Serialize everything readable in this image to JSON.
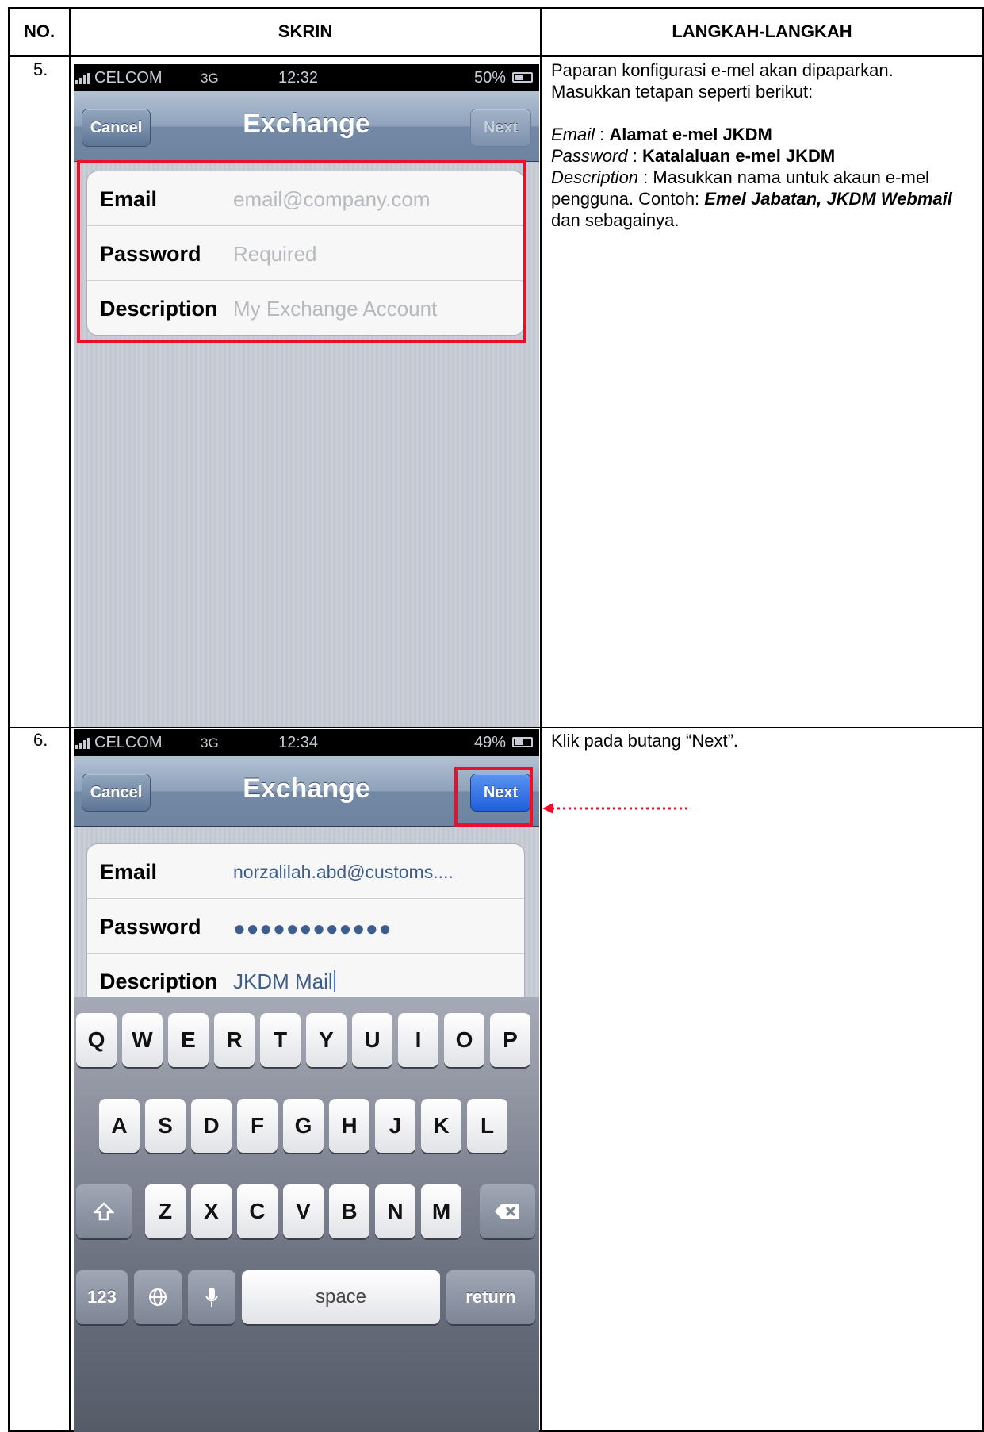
{
  "table": {
    "headers": [
      "NO.",
      "SKRIN",
      "LANGKAH-LANGKAH"
    ]
  },
  "rows": [
    {
      "number": "5.",
      "phone": {
        "carrier": "CELCOM",
        "network": "3G",
        "time": "12:32",
        "battery": "50%",
        "cancel": "Cancel",
        "title": "Exchange",
        "next": "Next",
        "fields": [
          {
            "label": "Email",
            "placeholder": "email@company.com"
          },
          {
            "label": "Password",
            "placeholder": "Required"
          },
          {
            "label": "Description",
            "placeholder": "My Exchange Account"
          }
        ]
      },
      "steps": {
        "intro": "Paparan konfigurasi e-mel akan dipaparkan. Masukkan tetapan seperti berikut:",
        "email_label": "Email",
        "email_value": "Alamat e-mel JKDM",
        "password_label": "Password",
        "password_value": "Katalaluan e-mel JKDM",
        "description_label": "Description",
        "description_text": "Masukkan nama untuk akaun e-mel  pengguna. Contoh:",
        "description_example": "Emel Jabatan, JKDM Webmail",
        "description_end": "dan sebagainya.",
        "separator": ":"
      }
    },
    {
      "number": "6.",
      "phone": {
        "carrier": "CELCOM",
        "network": "3G",
        "time": "12:34",
        "battery": "49%",
        "cancel": "Cancel",
        "title": "Exchange",
        "next": "Next",
        "fields": [
          {
            "label": "Email",
            "value": "norzalilah.abd@customs...."
          },
          {
            "label": "Password",
            "value": "●●●●●●●●●●●●"
          },
          {
            "label": "Description",
            "value": "JKDM Mail"
          }
        ],
        "keyboard": {
          "row1": [
            "Q",
            "W",
            "E",
            "R",
            "T",
            "Y",
            "U",
            "I",
            "O",
            "P"
          ],
          "row2": [
            "A",
            "S",
            "D",
            "F",
            "G",
            "H",
            "J",
            "K",
            "L"
          ],
          "row3": [
            "Z",
            "X",
            "C",
            "V",
            "B",
            "N",
            "M"
          ],
          "numbers": "123",
          "space": "space",
          "return": "return"
        }
      },
      "steps": {
        "text": "Klik pada butang “Next”."
      }
    }
  ],
  "colors": {
    "highlight": "#e8102a",
    "active_button": "#2f6fe4"
  }
}
